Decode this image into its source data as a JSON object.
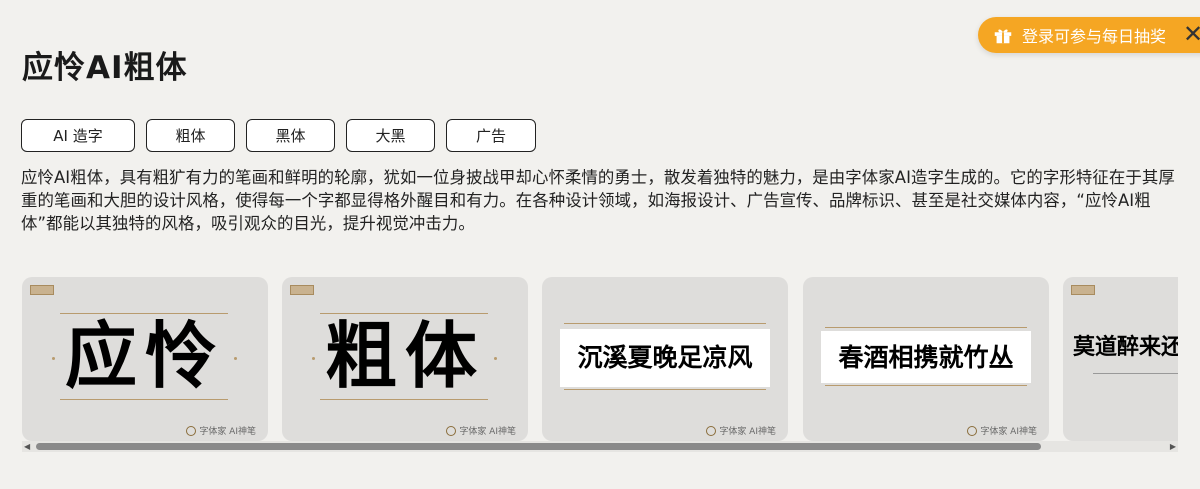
{
  "header": {
    "title": "应怜AI粗体"
  },
  "promo": {
    "label": "登录可参与每日抽奖",
    "icon": "gift-icon",
    "color": "#f5a623"
  },
  "close": {
    "glyph": "✕"
  },
  "tags": [
    "AI 造字",
    "粗体",
    "黑体",
    "大黑",
    "广告"
  ],
  "description": "应怜AI粗体，具有粗犷有力的笔画和鲜明的轮廓，犹如一位身披战甲却心怀柔情的勇士，散发着独特的魅力，是由字体家AI造字生成的。它的字形特征在于其厚重的笔画和大胆的设计风格，使得每一个字都显得格外醒目和有力。在各种设计领域，如海报设计、广告宣传、品牌标识、甚至是社交媒体内容，“应怜AI粗体”都能以其独特的风格，吸引观众的目光，提升视觉冲击力。",
  "gallery": {
    "cards": [
      {
        "sample": "应怜",
        "watermark": "字体家 AI神笔"
      },
      {
        "sample": "粗体",
        "watermark": "字体家 AI神笔"
      },
      {
        "sample": "沉溪夏晚足凉风",
        "watermark": "字体家 AI神笔"
      },
      {
        "sample": "春酒相携就竹丛",
        "watermark": "字体家 AI神笔"
      },
      {
        "sample": "莫道醉来还",
        "watermark": ""
      }
    ],
    "scroll_position": 0.0
  }
}
